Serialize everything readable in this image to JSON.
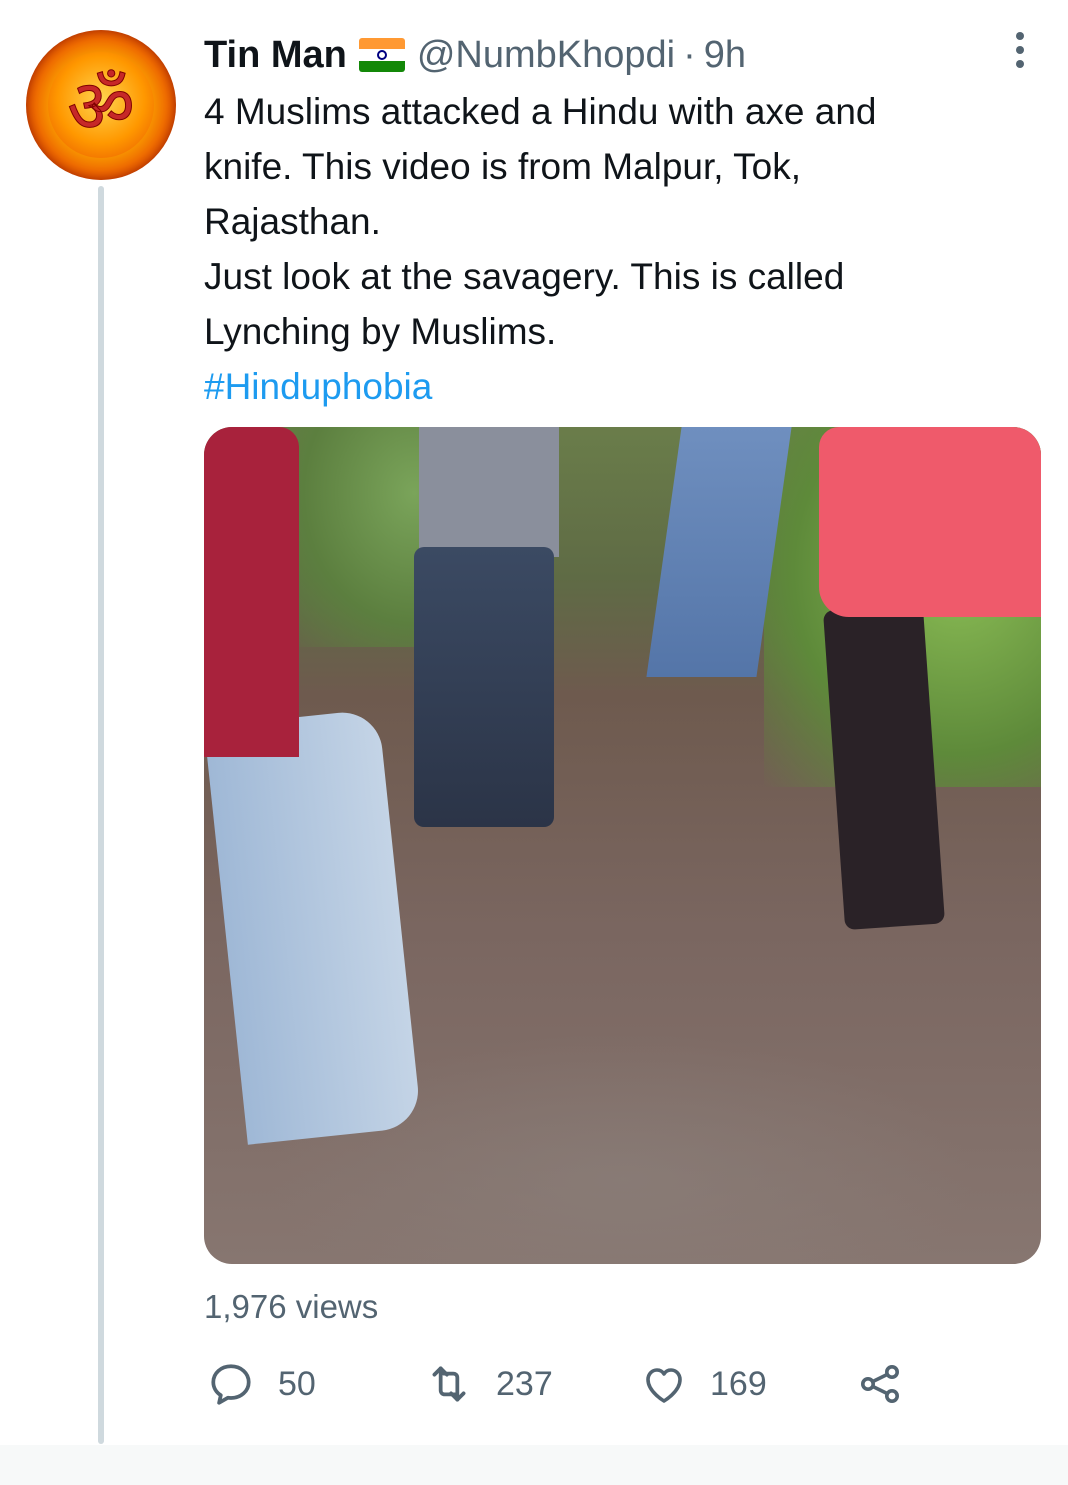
{
  "tweet": {
    "author": {
      "display_name": "Tin Man",
      "flag_icon": "india-flag-icon",
      "handle": "@NumbKhopdi",
      "avatar_glyph": "ॐ"
    },
    "separator": "·",
    "time": "9h",
    "text_lines": [
      "4 Muslims attacked a Hindu with axe and",
      "knife. This video is from Malpur, Tok,",
      "Rajasthan.",
      "Just look at the savagery. This is called",
      "Lynching by Muslims."
    ],
    "hashtag": "#Hinduphobia",
    "views": "1,976 views",
    "actions": {
      "reply_count": "50",
      "retweet_count": "237",
      "like_count": "169"
    }
  },
  "colors": {
    "text": "#0f1419",
    "secondary": "#536471",
    "link": "#1d9bf0",
    "thread_line": "#cfd9de"
  },
  "icons": [
    "reply-icon",
    "retweet-icon",
    "like-icon",
    "share-icon",
    "more-options-icon"
  ]
}
